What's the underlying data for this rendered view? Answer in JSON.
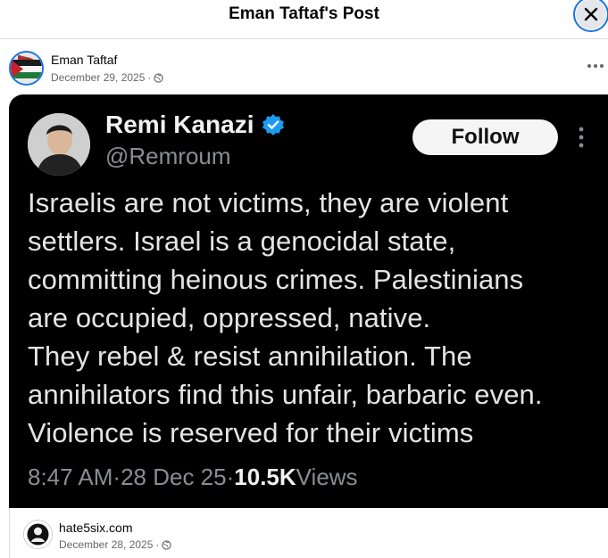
{
  "modal": {
    "title": "Eman Taftaf's Post"
  },
  "post": {
    "author": "Eman Taftaf",
    "date": "December 29, 2025",
    "separator": " · ",
    "privacy_icon": "globe-icon"
  },
  "tweet": {
    "name": "Remi Kanazi",
    "handle": "@Remroum",
    "follow_label": "Follow",
    "body": "Israelis are not victims, they are violent\nsettlers. Israel is a genocidal state,\ncommitting heinous crimes. Palestinians\nare occupied, oppressed, native.\nThey rebel & resist annihilation. The\nannihilators find this unfair, barbaric even.\nViolence is reserved for their victims",
    "time": "8:47 AM",
    "date": "28 Dec 25",
    "dot": " · ",
    "views_count": "10.5K",
    "views_label": " Views"
  },
  "source": {
    "name": "hate5six.com",
    "date": "December 28, 2025",
    "separator": " · "
  },
  "colors": {
    "accent": "#1b74e4",
    "verified": "#1d9bf0",
    "card_bg": "#000000",
    "meta": "#65676b"
  }
}
